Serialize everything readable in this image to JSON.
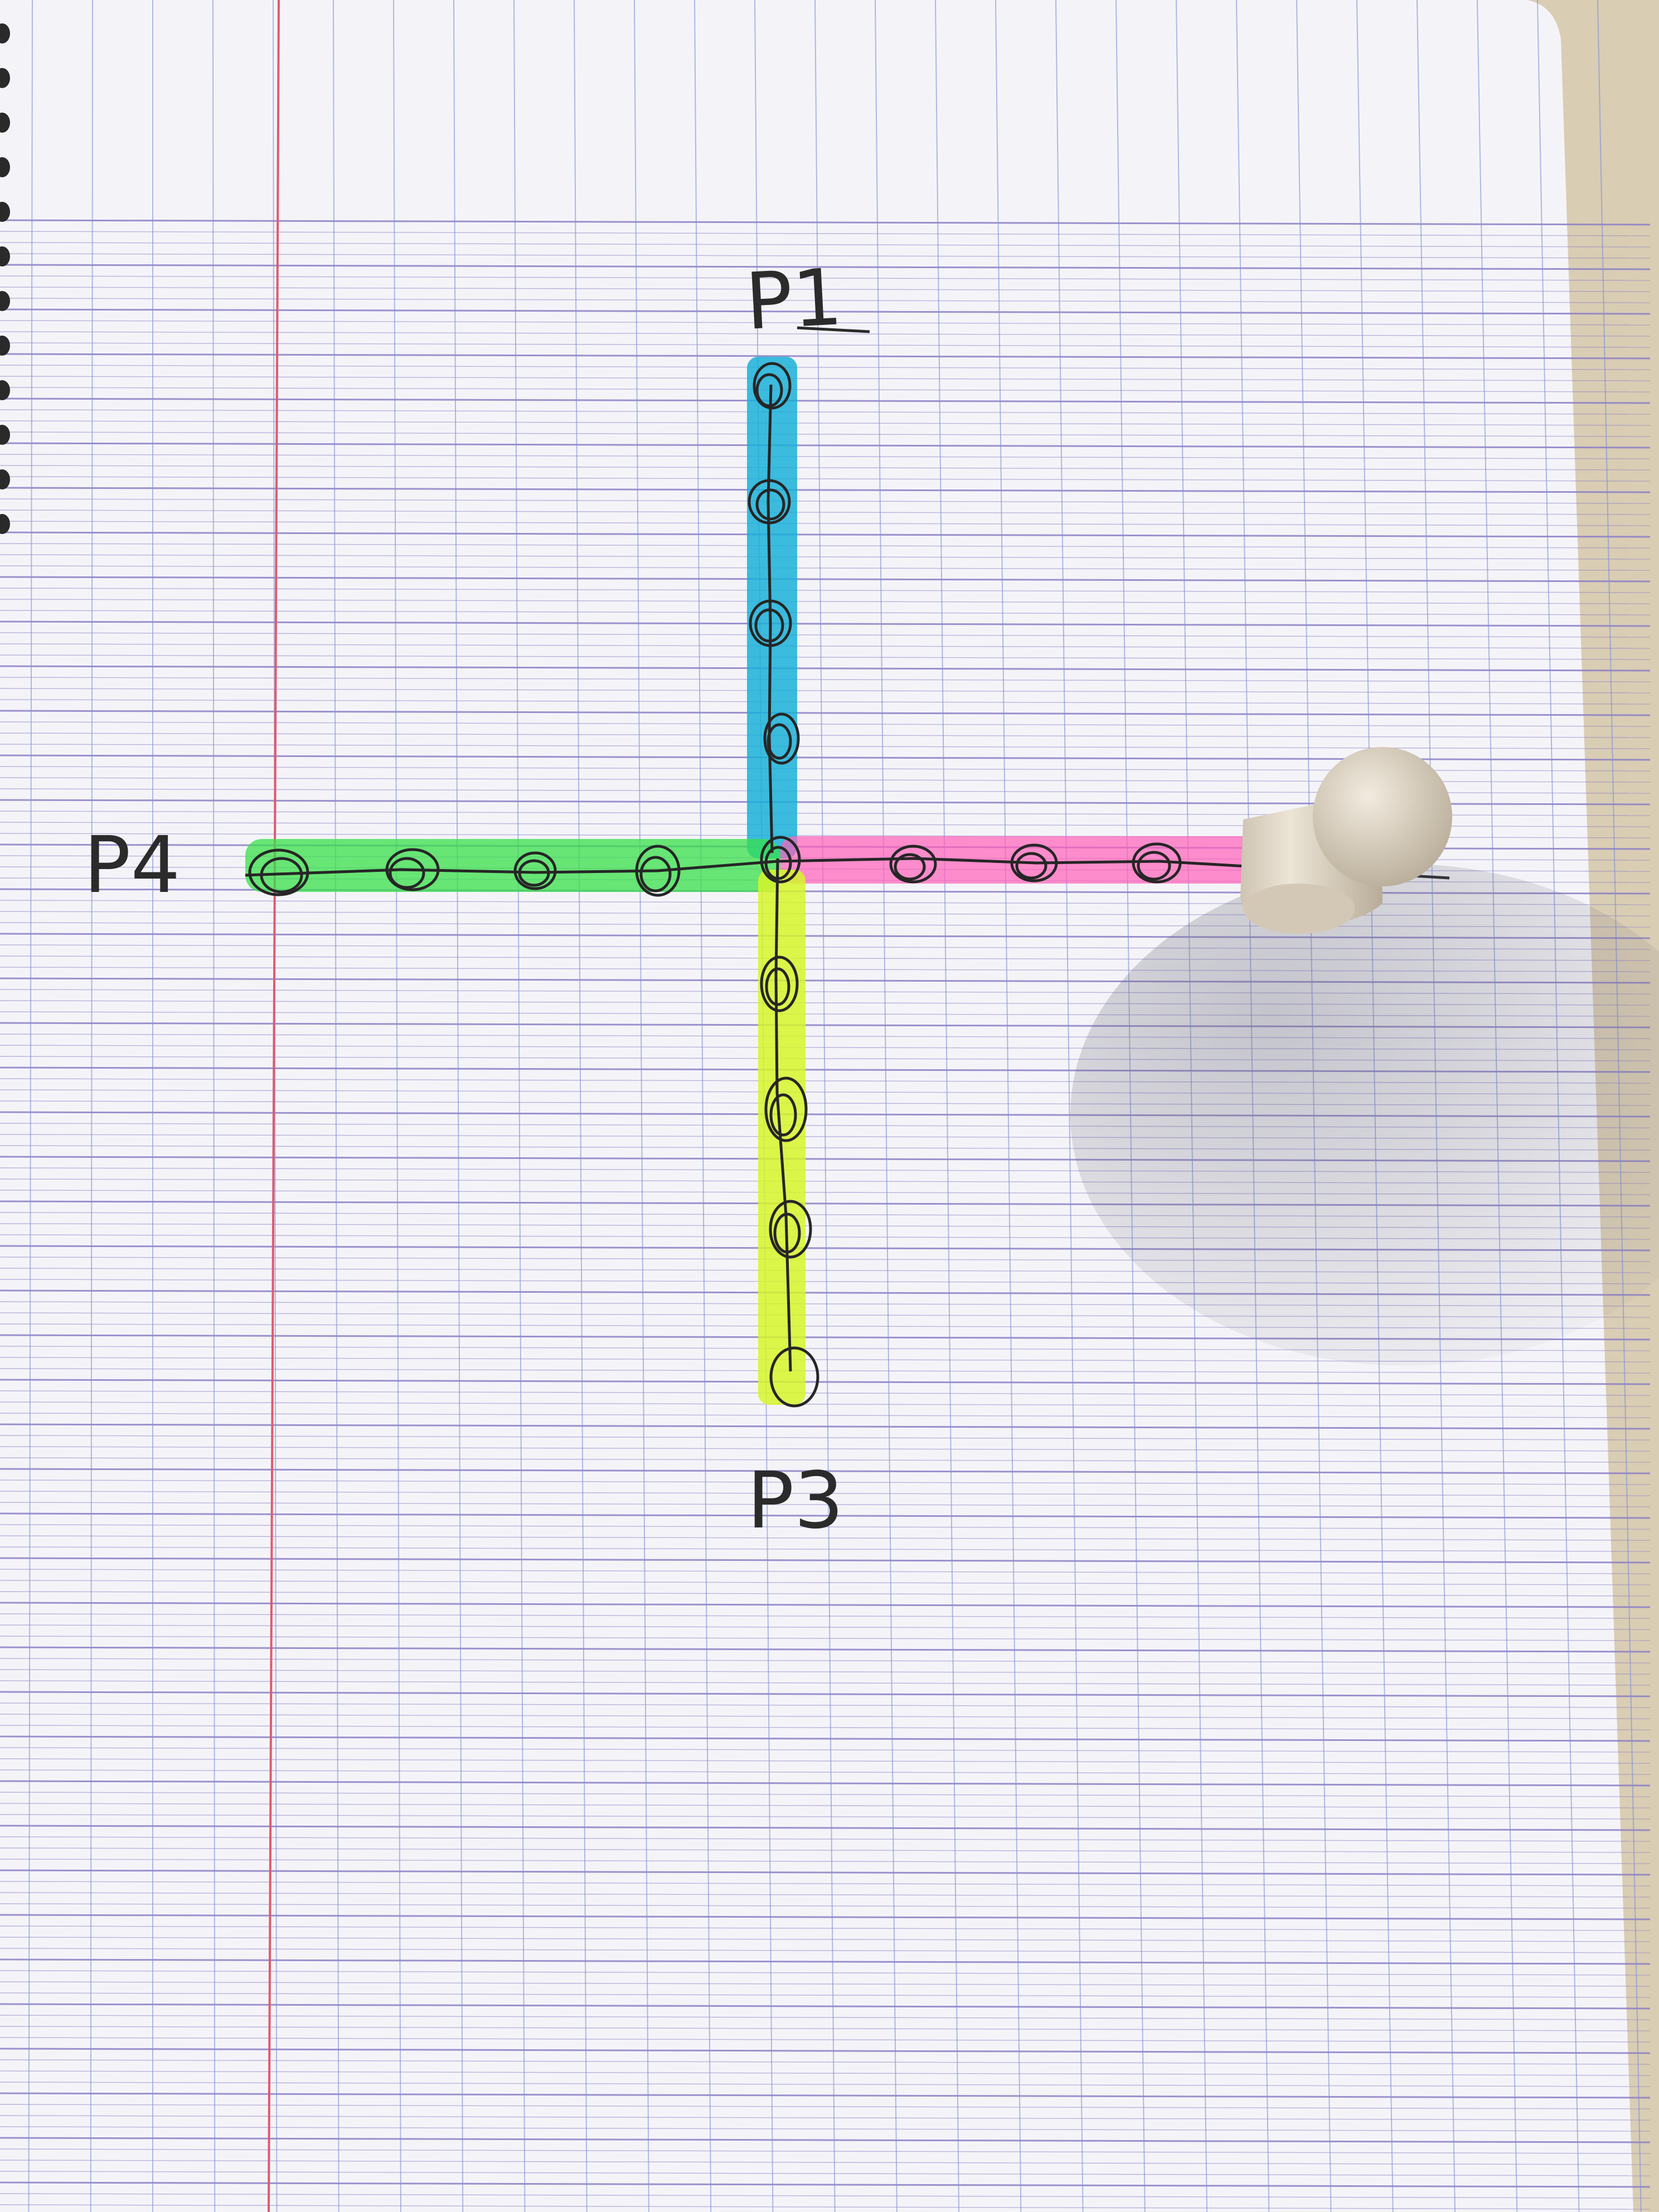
{
  "labels": {
    "top": "P1",
    "left": "P4",
    "bottom": "P3"
  },
  "colors": {
    "paper": "#f4f4f8",
    "desk": "#d9cdb4",
    "horizontal_rule": "#8c7fc6",
    "vertical_rule": "#7f8fd6",
    "margin_line": "#e05a6e",
    "ink": "#262626",
    "highlight_top": "#1ab0d8",
    "highlight_left": "#38e04a",
    "highlight_right": "#ff5fb8",
    "highlight_bottom": "#d6f52a",
    "pawn": "#e6ddcf"
  },
  "arms": [
    {
      "side": "top",
      "highlight": "blue",
      "circle_count": 4
    },
    {
      "side": "left",
      "highlight": "green",
      "circle_count": 4
    },
    {
      "side": "right",
      "highlight": "pink",
      "circle_count": 3
    },
    {
      "side": "bottom",
      "highlight": "yellow",
      "circle_count": 4
    }
  ],
  "objects": [
    "pawn-figure",
    "spiral-binding",
    "center-circle"
  ]
}
